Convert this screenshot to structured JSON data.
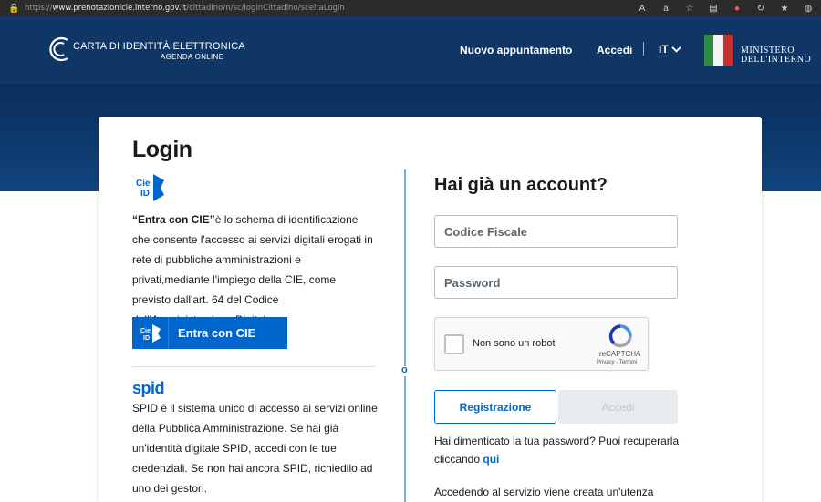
{
  "browser": {
    "url_prefix": "https://",
    "url_host": "www.prenotazionicie.interno.gov.it",
    "url_path": "/cittadino/n/sc/loginCittadino/sceltaLogin"
  },
  "header": {
    "brand_title": "CARTA DI IDENTITÀ ELETTRONICA",
    "brand_subtitle": "AGENDA ONLINE",
    "nav_new_appointment": "Nuovo appuntamento",
    "nav_login": "Accedi",
    "nav_language": "IT",
    "ministry_line1": "MINISTERO",
    "ministry_line2": "DELL'INTERNO"
  },
  "login": {
    "title": "Login",
    "cie": {
      "logo_text_top": "Cie",
      "logo_text_bottom": "ID",
      "description_bold": "“Entra con CIE”",
      "description_rest": "è lo schema di identificazione che consente l'accesso ai servizi digitali erogati in rete di pubbliche amministrazioni e privati,mediante l'impiego della CIE, come previsto dall'art. 64 del Codice dell'Amministrazione Digitale",
      "button_label": "Entra con CIE"
    },
    "divider_label": "o",
    "spid": {
      "logo": "spid",
      "description": "SPID è il sistema unico di accesso ai servizi online della Pubblica Amministrazione. Se hai già un'identità digitale SPID, accedi con le tue credenziali. Se non hai ancora SPID, richiedilo ad uno dei gestori."
    },
    "account": {
      "title": "Hai già un account?",
      "codice_fiscale_placeholder": "Codice Fiscale",
      "password_placeholder": "Password",
      "recaptcha_label": "Non sono un robot",
      "recaptcha_brand": "reCAPTCHA",
      "recaptcha_links": "Privacy - Termini",
      "register_button": "Registrazione",
      "login_button": "Accedi",
      "forgot_text": "Hai dimenticato la tua password? Puoi recuperarla cliccando ",
      "forgot_link": "qui",
      "footer_text": "Accedendo al servizio viene creata un'utenza"
    }
  },
  "colors": {
    "header_bg": "#0f3664",
    "accent": "#0066cc",
    "flag_green": "#2e8b45",
    "flag_red": "#c6312f"
  },
  "icons": [
    "lock-icon",
    "cie-id-logo-icon",
    "recaptcha-icon",
    "chevron-down-icon"
  ]
}
